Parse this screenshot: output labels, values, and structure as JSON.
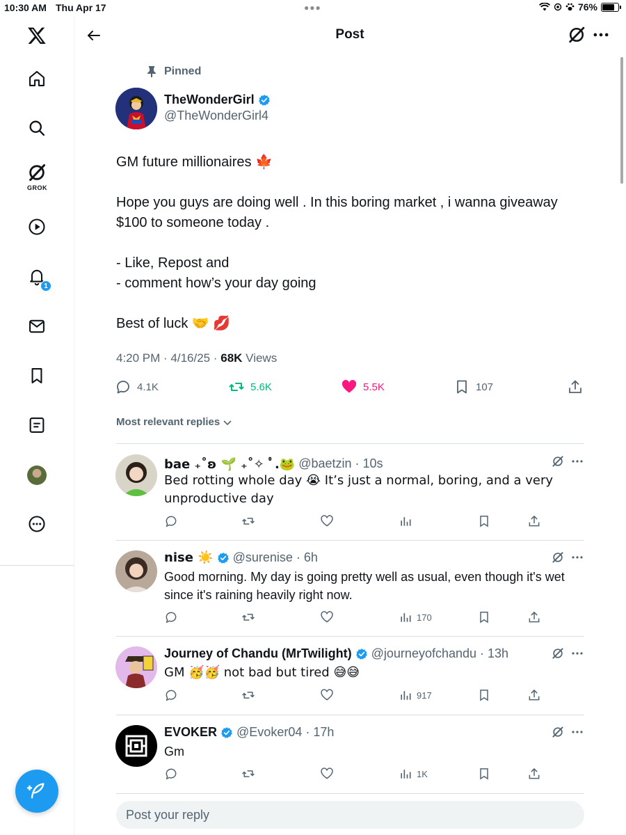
{
  "status_bar": {
    "time": "10:30 AM",
    "date": "Thu Apr 17",
    "battery": "76%"
  },
  "sidebar": {
    "grok_label": "GROK",
    "notification_count": "1",
    "items": [
      "home-icon",
      "search-icon",
      "grok-icon",
      "video-icon",
      "notifications-icon",
      "messages-icon",
      "bookmarks-icon",
      "lists-icon",
      "profile-avatar",
      "more-icon"
    ]
  },
  "header": {
    "title": "Post"
  },
  "post": {
    "pinned_label": "Pinned",
    "author_name": "TheWonderGirl",
    "author_handle": "@TheWonderGirl4",
    "body": "GM future millionaires 🍁\n\nHope you guys are doing well . In this boring market , i wanna giveaway $100 to someone today .\n\n- Like, Repost and\n- comment how’s your day going\n\nBest of luck 🤝 💋",
    "time": "4:20 PM · 4/16/25 · ",
    "views_count": "68K",
    "views_label": " Views",
    "replies": "4.1K",
    "reposts": "5.6K",
    "likes": "5.5K",
    "bookmarks": "107",
    "reposts_color": "#00ba7c",
    "likes_color": "#f91880"
  },
  "replies_sort": "Most relevant replies",
  "replies": [
    {
      "name": "bae ₊˚ʚ 🌱 ₊˚✧ ﾟ.🐸",
      "handle": "@baetzin · 10s",
      "verified": false,
      "text": "Bed rotting whole day 😭 It’s just a normal, boring, and a very unproductive day",
      "views": ""
    },
    {
      "name": "nise ☀️",
      "handle": "@surenise · 6h",
      "verified": true,
      "text": "Good morning. My day is going pretty well as usual, even though it's wet since it's raining heavily right now.",
      "views": "170"
    },
    {
      "name": "Journey of Chandu (MrTwilight)",
      "handle": "@journeyofchandu · 13h",
      "verified": true,
      "text": "GM 🥳🥳 not bad but tired 😅😅",
      "views": "917"
    },
    {
      "name": "EVOKER",
      "handle": "@Evoker04 · 17h",
      "verified": true,
      "text": "Gm",
      "views": "1K"
    }
  ],
  "composer": {
    "placeholder": "Post your reply"
  },
  "colors": {
    "accent": "#1d9bf0",
    "secondary_text": "#536471"
  }
}
